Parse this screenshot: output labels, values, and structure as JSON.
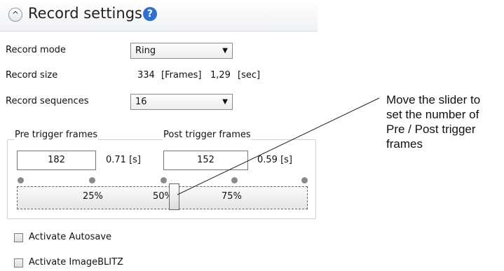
{
  "panel": {
    "title": "Record settings",
    "help_glyph": "?",
    "collapse_glyph": "^",
    "record_mode": {
      "label": "Record mode",
      "value": "Ring"
    },
    "record_size": {
      "label": "Record size",
      "frames": "334",
      "frames_unit": "[Frames]",
      "seconds": "1,29",
      "seconds_unit": "[sec]"
    },
    "record_sequences": {
      "label": "Record sequences",
      "value": "16"
    }
  },
  "trigger": {
    "pre_label": "Pre trigger frames",
    "post_label": "Post trigger frames",
    "pre_value": "182",
    "pre_seconds": "0.71 [s]",
    "post_value": "152",
    "post_seconds": "0.59 [s]",
    "slider": {
      "ticks": [
        "25%",
        "50%",
        "75%"
      ],
      "position_percent": 54
    }
  },
  "checkboxes": {
    "autosave": {
      "label": "Activate Autosave",
      "checked": false
    },
    "imageblitz": {
      "label": "Activate ImageBLITZ",
      "checked": false
    }
  },
  "annotation": {
    "lines": [
      "Move the slider to",
      "set the number of",
      "Pre / Post trigger",
      "frames"
    ]
  },
  "icons": {
    "collapse": "chevron-up-icon",
    "help": "help-icon",
    "dropdown": "chevron-down-icon"
  },
  "colors": {
    "help_icon": "#2e6fd0",
    "header_border": "#d6d9dd"
  }
}
